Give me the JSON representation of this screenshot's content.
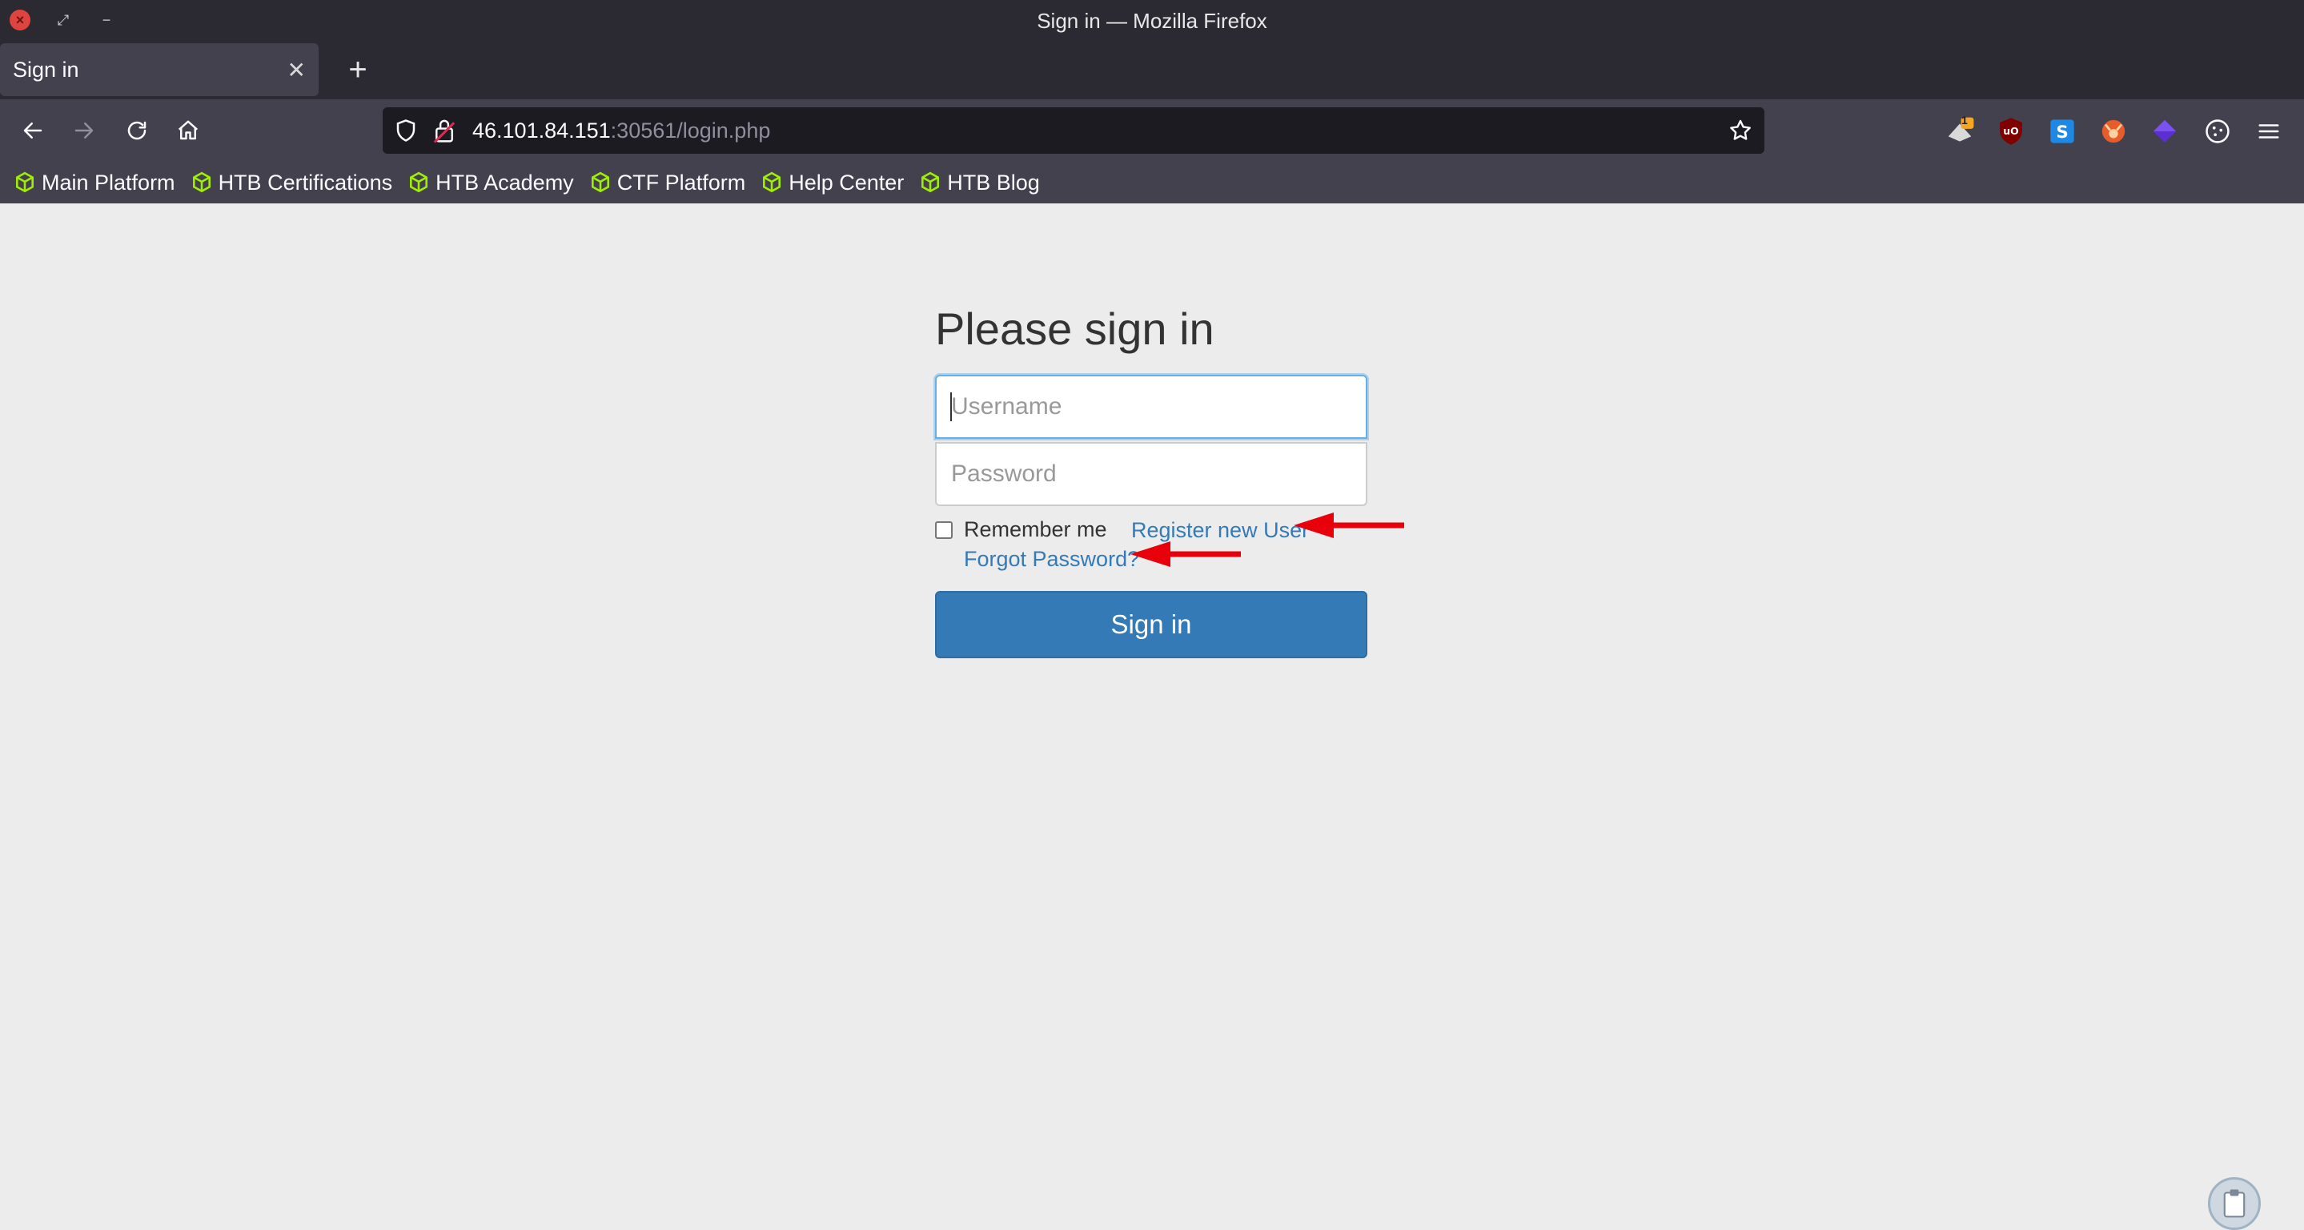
{
  "window": {
    "title": "Sign in — Mozilla Firefox"
  },
  "tabs": [
    {
      "label": "Sign in",
      "active": true
    }
  ],
  "newtab_label": "+",
  "url": {
    "host": "46.101.84.151",
    "rest": ":30561/login.php"
  },
  "bookmarks": [
    "Main Platform",
    "HTB Certifications",
    "HTB Academy",
    "CTF Platform",
    "Help Center",
    "HTB Blog"
  ],
  "form": {
    "heading": "Please sign in",
    "username_placeholder": "Username",
    "password_placeholder": "Password",
    "remember_label": "Remember me",
    "register_link": "Register new User",
    "forgot_link": "Forgot Password?",
    "submit_label": "Sign in"
  },
  "extensions": {
    "badge_count": "1"
  },
  "colors": {
    "chrome_dark": "#2b2a33",
    "chrome_toolbar": "#42414d",
    "page_bg": "#ececec",
    "primary": "#337ab7",
    "link": "#337ab7",
    "annotation_arrow": "#e8000b",
    "bookmark_icon": "#9fef00"
  },
  "icons": [
    "close-icon",
    "back-arrow-icon",
    "forward-arrow-icon",
    "reload-icon",
    "home-icon",
    "shield-icon",
    "lock-icon",
    "star-icon",
    "hackbox-badge-icon",
    "ublock-icon",
    "s-extension-icon",
    "fox-extension-icon",
    "purple-cube-icon",
    "cookie-icon",
    "hamburger-menu-icon",
    "htb-cube-icon",
    "clipboard-icon"
  ]
}
